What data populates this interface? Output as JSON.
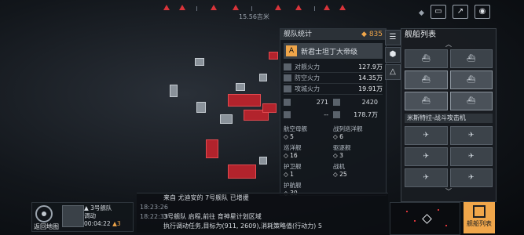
{
  "hud": {
    "distance": "15.56吉米"
  },
  "stats_panel": {
    "title": "舰队统计",
    "resource": "835",
    "fleet_name": "新君士坦丁大帝级",
    "stats": [
      {
        "label": "对舰火力",
        "value": "127.9万"
      },
      {
        "label": "防空火力",
        "value": "14.35万"
      },
      {
        "label": "攻城火力",
        "value": "19.91万"
      }
    ],
    "extra": [
      {
        "left": "271",
        "right": "2420"
      },
      {
        "left": "--",
        "right": "178.7万"
      }
    ],
    "ship_types": [
      {
        "name": "航空母舰",
        "count": "5"
      },
      {
        "name": "战列巡洋舰",
        "count": "6"
      },
      {
        "name": "巡洋舰",
        "count": "16"
      },
      {
        "name": "驱逐舰",
        "count": "3"
      },
      {
        "name": "护卫舰",
        "count": "1"
      },
      {
        "name": "战机",
        "count": "25"
      },
      {
        "name": "护航舰",
        "count": "30"
      }
    ]
  },
  "ship_list": {
    "title": "舰船列表",
    "subheader": "米斯特拉-战斗攻击机"
  },
  "fleet_card": {
    "back_label": "返回地图",
    "fleet": "3号舰队",
    "status": "调动",
    "time": "00:04:22",
    "count": "3"
  },
  "log": [
    {
      "time": "",
      "msg": "来自 尤迪安的 7号舰队 已增援"
    },
    {
      "time": "18:23:26",
      "msg": ""
    },
    {
      "time": "18:22:33",
      "msg": "3号舰队 启程,前往 育神星计划区域"
    },
    {
      "time": "",
      "msg": "执行调动任务,目标为(911, 2609),消耗策略值(行动力) 5"
    }
  ],
  "list_button": {
    "label": "舰船列表"
  }
}
